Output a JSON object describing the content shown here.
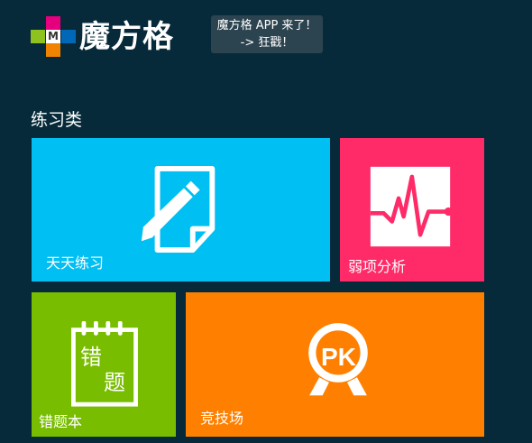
{
  "header": {
    "logo_letter": "M",
    "logo_text": "魔方格",
    "app_badge_line1": "魔方格 APP 来了！",
    "app_badge_line2": "-> 狂戳！",
    "logo_colors": [
      "#e6007e",
      "#8dc21f",
      "#0068b7",
      "#f08300",
      "#9b9b9b"
    ]
  },
  "section": {
    "title": "练习类"
  },
  "tiles": [
    {
      "label": "天天练习",
      "icon": "pencil-paper-icon",
      "color": "#00bff3"
    },
    {
      "label": "弱项分析",
      "icon": "pulse-chart-icon",
      "color": "#ff2a68"
    },
    {
      "label": "错题本",
      "icon": "notebook-icon",
      "color": "#78bd00",
      "icon_text_1": "错",
      "icon_text_2": "题"
    },
    {
      "label": "竞技场",
      "icon": "pk-medal-icon",
      "color": "#ff8000",
      "icon_text": "PK"
    }
  ]
}
